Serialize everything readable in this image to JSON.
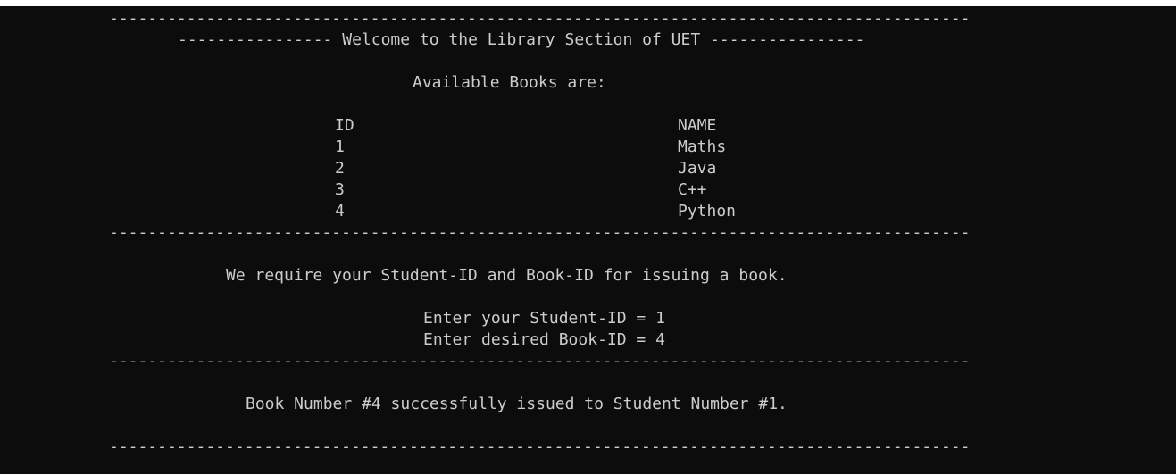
{
  "console": {
    "rule_top": "-----------------------------------------------------------------------------------------",
    "welcome": "---------------- Welcome to the Library Section of UET ----------------",
    "available_books": "Available Books are:",
    "table": {
      "header_id": "ID",
      "header_name": "NAME",
      "rows": [
        {
          "id": "1",
          "name": "Maths"
        },
        {
          "id": "2",
          "name": "Java"
        },
        {
          "id": "3",
          "name": "C++"
        },
        {
          "id": "4",
          "name": "Python"
        }
      ]
    },
    "rule_2": "-----------------------------------------------------------------------------------------",
    "require_msg": "We require your Student-ID and Book-ID for issuing a book.",
    "prompt_student": "Enter your Student-ID = 1",
    "prompt_book": "Enter desired Book-ID = 4",
    "rule_3": "-----------------------------------------------------------------------------------------",
    "success_msg": "Book Number #4 successfully issued to Student Number #1.",
    "rule_4": "-----------------------------------------------------------------------------------------"
  }
}
